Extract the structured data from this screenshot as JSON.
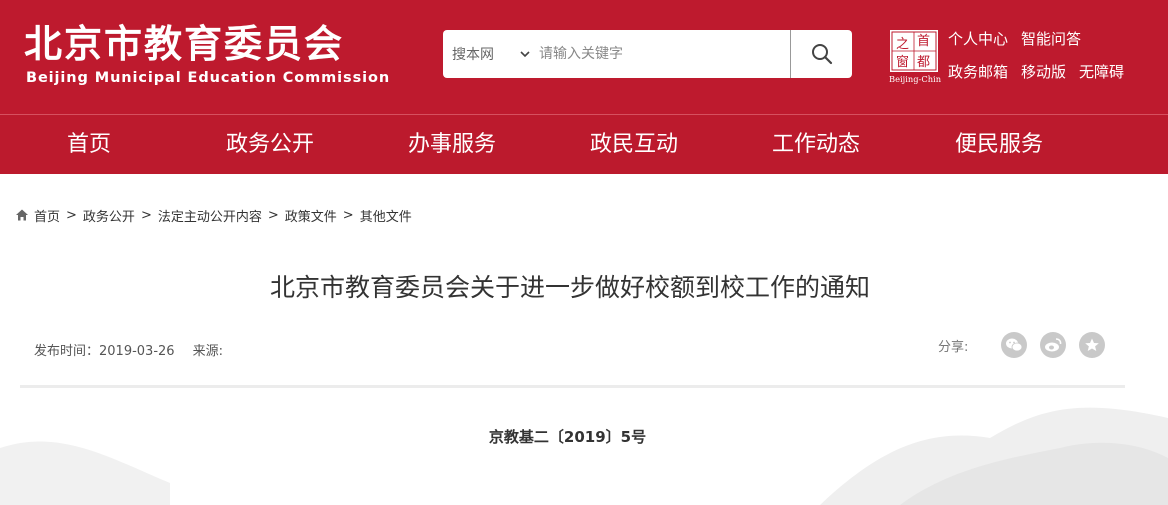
{
  "header": {
    "logo_cn": "北京市教育委员会",
    "logo_en": "Beijing Municipal Education Commission",
    "bg_color": "#be1a2e",
    "search": {
      "scope_label": "搜本网",
      "placeholder": "请输入关键字",
      "button_icon": "search-icon"
    },
    "capital_logo": {
      "chars": [
        "之",
        "首",
        "窗",
        "都"
      ],
      "caption": "Beijing-China"
    },
    "links_row1": [
      "个人中心",
      "智能问答"
    ],
    "links_row2": [
      "政务邮箱",
      "移动版",
      "无障碍"
    ]
  },
  "nav": {
    "items": [
      "首页",
      "政务公开",
      "办事服务",
      "政民互动",
      "工作动态",
      "便民服务"
    ]
  },
  "breadcrumb": {
    "home_icon": "home-icon",
    "items": [
      "首页",
      "政务公开",
      "法定主动公开内容",
      "政策文件",
      "其他文件"
    ],
    "separator": ">"
  },
  "article": {
    "title": "北京市教育委员会关于进一步做好校额到校工作的通知",
    "publish_label": "发布时间：",
    "publish_date": "2019-03-26",
    "source_label": "来源:",
    "share_label": "分享:",
    "share_icons": [
      "wechat-icon",
      "weibo-icon",
      "favorite-star-icon"
    ],
    "doc_number": "京教基二〔2019〕5号"
  }
}
